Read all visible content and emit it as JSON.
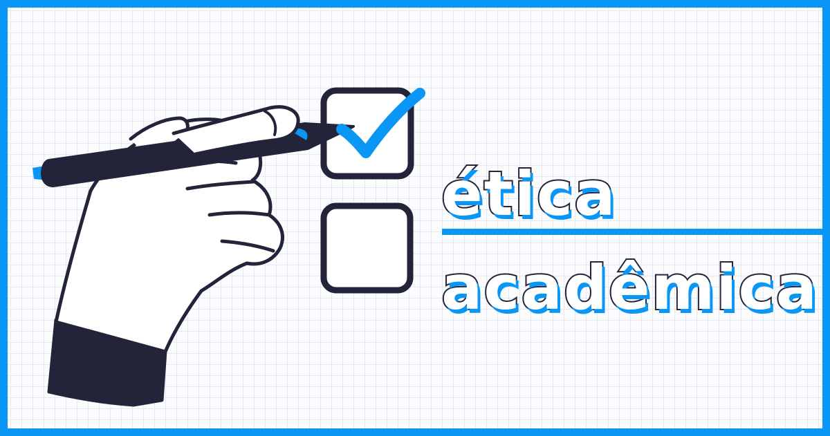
{
  "title": {
    "line1": "ética",
    "line2": "acadêmica"
  },
  "colors": {
    "accent": "#0996f5",
    "ink": "#23233a",
    "paper": "#fbfcfd"
  },
  "illustration": {
    "icons": [
      "hand-icon",
      "pen-icon",
      "checkbox-checked-icon",
      "checkbox-empty-icon",
      "checkmark-icon"
    ],
    "checkboxes": [
      {
        "checked": true
      },
      {
        "checked": false
      }
    ]
  }
}
